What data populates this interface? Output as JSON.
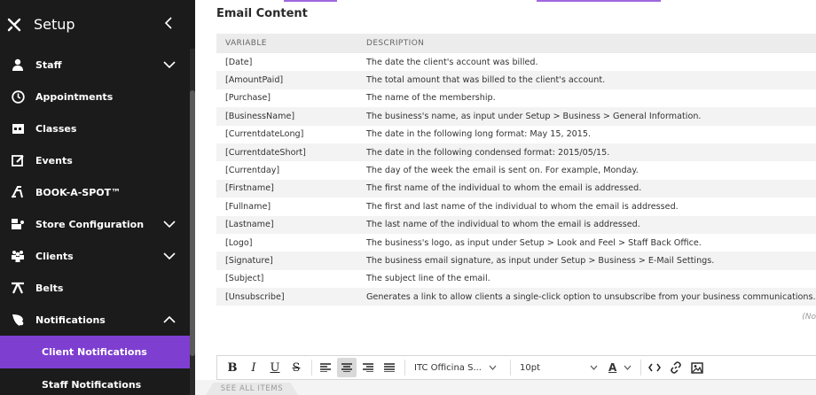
{
  "sidebar": {
    "title": "Setup",
    "items": [
      {
        "label": "Staff",
        "icon": "person-icon",
        "chevron": "down"
      },
      {
        "label": "Appointments",
        "icon": "clock-icon",
        "chevron": ""
      },
      {
        "label": "Classes",
        "icon": "calendar-icon",
        "chevron": ""
      },
      {
        "label": "Events",
        "icon": "edit-icon",
        "chevron": ""
      },
      {
        "label": "BOOK-A-SPOT™",
        "icon": "bike-icon",
        "chevron": ""
      },
      {
        "label": "Store Configuration",
        "icon": "store-icon",
        "chevron": "down"
      },
      {
        "label": "Clients",
        "icon": "users-icon",
        "chevron": "down"
      },
      {
        "label": "Belts",
        "icon": "belt-icon",
        "chevron": ""
      },
      {
        "label": "Notifications",
        "icon": "bullhorn-icon",
        "chevron": "up"
      }
    ],
    "sub_items": [
      {
        "label": "Client Notifications",
        "active": true
      },
      {
        "label": "Staff Notifications",
        "active": false
      }
    ]
  },
  "main": {
    "section_title": "Email Content",
    "table": {
      "headers": [
        "VARIABLE",
        "DESCRIPTION"
      ],
      "rows": [
        [
          "[Date]",
          "The date the client's account was billed."
        ],
        [
          "[AmountPaid]",
          "The total amount that was billed to the client's account."
        ],
        [
          "[Purchase]",
          "The name of the membership."
        ],
        [
          "[BusinessName]",
          "The business's name, as input under Setup > Business > General Information."
        ],
        [
          "[CurrentdateLong]",
          "The date in the following long format: May 15, 2015."
        ],
        [
          "[CurrentdateShort]",
          "The date in the following condensed format: 2015/05/15."
        ],
        [
          "[Currentday]",
          "The day of the week the email is sent on. For example, Monday."
        ],
        [
          "[Firstname]",
          "The first name of the individual to whom the email is addressed."
        ],
        [
          "[Fullname]",
          "The first and last name of the individual to whom the email is addressed."
        ],
        [
          "[Lastname]",
          "The last name of the individual to whom the email is addressed."
        ],
        [
          "[Logo]",
          "The business's logo, as input under Setup > Look and Feel > Staff Back Office."
        ],
        [
          "[Signature]",
          "The business email signature, as input under Setup > Business > E-Mail Settings."
        ],
        [
          "[Subject]",
          "The subject line of the email."
        ],
        [
          "[Unsubscribe]",
          "Generates a link to allow clients a single-click option to unsubscribe from your business communications."
        ]
      ]
    },
    "note": "(No",
    "toolbar": {
      "bold": "B",
      "italic": "I",
      "underline": "U",
      "strike": "S",
      "font": "ITC Officina S...",
      "size": "10pt",
      "color_letter": "A"
    },
    "see_all": "SEE ALL ITEMS"
  },
  "colors": {
    "sidebar_bg": "#1b1b1b",
    "accent": "#7e3fd1"
  }
}
